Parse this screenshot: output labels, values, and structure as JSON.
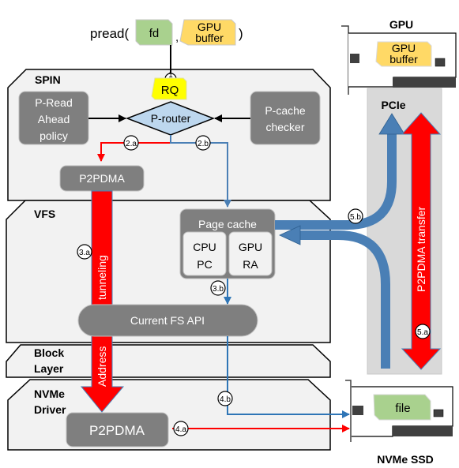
{
  "call": {
    "func": "pread(",
    "arg1": "fd",
    "sep": ",",
    "arg2_line1": "GPU",
    "arg2_line2": "buffer",
    "close": ")"
  },
  "layers": {
    "spin": "SPIN",
    "vfs": "VFS",
    "block_line1": "Block",
    "block_line2": "Layer",
    "nvme_line1": "NVMe",
    "nvme_line2": "Driver"
  },
  "spin": {
    "rq": "RQ",
    "router": "P-router",
    "readahead": [
      "P-Read",
      "Ahead",
      "policy"
    ],
    "checker": [
      "P-cache",
      "checker"
    ],
    "p2pdma": "P2PDMA"
  },
  "vfs": {
    "page_cache": "Page cache",
    "cpu_pc": [
      "CPU",
      "PC"
    ],
    "gpu_ra": [
      "GPU",
      "RA"
    ],
    "fs_api": "Current FS API"
  },
  "nvme": {
    "p2pdma": "P2PDMA"
  },
  "tunnel": {
    "upper": "tunneling",
    "lower": "Address"
  },
  "gpu_card": {
    "title": "GPU",
    "buffer_line1": "GPU",
    "buffer_line2": "buffer"
  },
  "pcie": {
    "title": "PCIe",
    "transfer": "P2PDMA transfer"
  },
  "ssd": {
    "title": "NVMe SSD",
    "file": "file"
  },
  "steps": {
    "s1": "1",
    "s2a": "2.a",
    "s2b": "2.b",
    "s3a": "3.a",
    "s3b": "3.b",
    "s4a": "4.a",
    "s4b": "4.b",
    "s5a": "5.a",
    "s5b": "5.b"
  },
  "colors": {
    "red_path": "#ff0000",
    "blue_path": "#4a7fb5",
    "gray_box": "#7f7f7f",
    "layer_fill": "#f2f2f2",
    "router_fill": "#bdd7ee",
    "fd_fill": "#a9d18e",
    "buffer_fill": "#ffd966",
    "rq_fill": "#ffff00",
    "pcie_fill": "#d9d9d9"
  }
}
